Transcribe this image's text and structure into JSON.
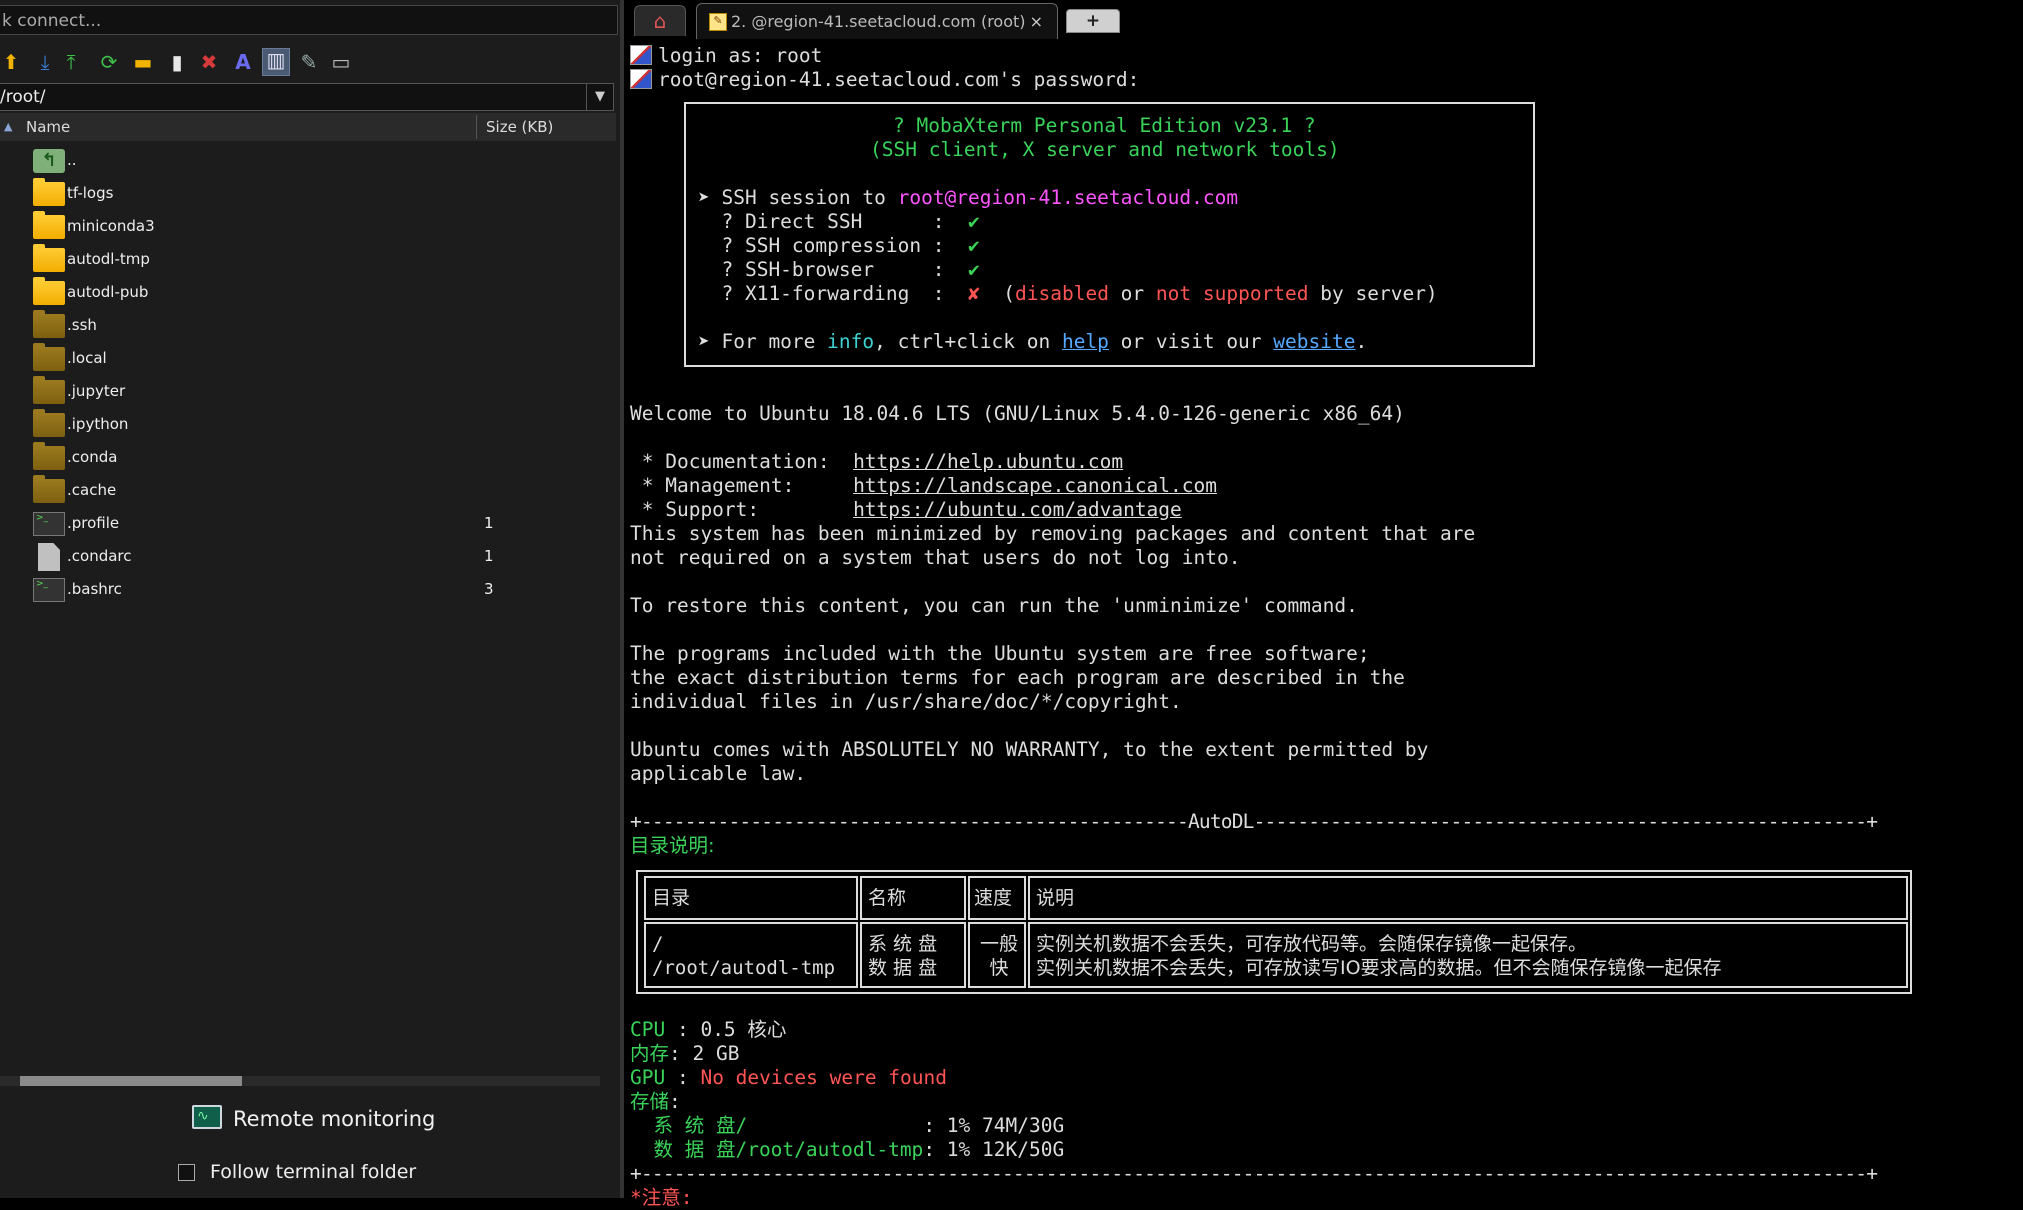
{
  "left_panel": {
    "quick_connect": "k connect...",
    "path": "/root/",
    "columns": {
      "name": "Name",
      "size": "Size (KB)"
    },
    "files": [
      {
        "name": "..",
        "size": "",
        "icon": "up-folder-icon"
      },
      {
        "name": "tf-logs",
        "size": "",
        "icon": "folder-icon"
      },
      {
        "name": "miniconda3",
        "size": "",
        "icon": "folder-icon"
      },
      {
        "name": "autodl-tmp",
        "size": "",
        "icon": "folder-icon"
      },
      {
        "name": "autodl-pub",
        "size": "",
        "icon": "folder-icon"
      },
      {
        "name": ".ssh",
        "size": "",
        "icon": "hidden-folder-icon"
      },
      {
        "name": ".local",
        "size": "",
        "icon": "hidden-folder-icon"
      },
      {
        "name": ".jupyter",
        "size": "",
        "icon": "hidden-folder-icon"
      },
      {
        "name": ".ipython",
        "size": "",
        "icon": "hidden-folder-icon"
      },
      {
        "name": ".conda",
        "size": "",
        "icon": "hidden-folder-icon"
      },
      {
        "name": ".cache",
        "size": "",
        "icon": "hidden-folder-icon"
      },
      {
        "name": ".profile",
        "size": "1",
        "icon": "terminal-file-icon"
      },
      {
        "name": ".condarc",
        "size": "1",
        "icon": "document-file-icon"
      },
      {
        "name": ".bashrc",
        "size": "3",
        "icon": "terminal-file-icon"
      }
    ],
    "remote_monitoring": "Remote monitoring",
    "follow_terminal": "Follow terminal folder"
  },
  "tabs": {
    "home_icon": "home-icon",
    "active_label": "2. @region-41.seetacloud.com (root)",
    "close": "×",
    "new_tab": "+"
  },
  "terminal": {
    "login": "login as: root",
    "password": "root@region-41.seetacloud.com's password:",
    "banner": {
      "title": "? MobaXterm Personal Edition v23.1 ?",
      "subtitle": "(SSH client, X server and network tools)",
      "session_prefix": "➤ SSH session to ",
      "session_host": "root@region-41.seetacloud.com",
      "direct_ssh": "  ? Direct SSH      :  ",
      "compression": "  ? SSH compression :  ",
      "browser": "  ? SSH-browser     :  ",
      "x11": "  ? X11-forwarding  :  ",
      "check": "✔",
      "cross": "✘",
      "x11_open": "  (",
      "disabled": "disabled",
      "or": " or ",
      "not_supported": "not supported",
      "by_server": " by server)",
      "more_prefix": "➤ For more ",
      "info": "info",
      "ctrl_click": ", ctrl+click on ",
      "help": "help",
      "or_visit": " or visit our ",
      "website": "website",
      "dot": "."
    },
    "welcome": "Welcome to Ubuntu 18.04.6 LTS (GNU/Linux 5.4.0-126-generic x86_64)",
    "doc_label": " * Documentation:  ",
    "doc_url": "https://help.ubuntu.com",
    "mgmt_label": " * Management:     ",
    "mgmt_url": "https://landscape.canonical.com",
    "support_label": " * Support:        ",
    "support_url": "https://ubuntu.com/advantage",
    "minimized1": "This system has been minimized by removing packages and content that are",
    "minimized2": "not required on a system that users do not log into.",
    "restore": "To restore this content, you can run the 'unminimize' command.",
    "programs1": "The programs included with the Ubuntu system are free software;",
    "programs2": "the exact distribution terms for each program are described in the",
    "programs3": "individual files in /usr/share/doc/*/copyright.",
    "warranty1": "Ubuntu comes with ABSOLUTELY NO WARRANTY, to the extent permitted by",
    "warranty2": "applicable law.",
    "autodl_rule": "+--------------------------------------------------AutoDL--------------------------------------------------------+",
    "dir_heading": "目录说明:",
    "table": {
      "h_dir": "目录",
      "h_name": "名称",
      "h_speed": "速度",
      "h_desc": "说明",
      "r1_dir": "/",
      "r2_dir": "/root/autodl-tmp",
      "r1_name": "系 统 盘",
      "r2_name": "数 据 盘",
      "r1_speed": "一般",
      "r2_speed": "快",
      "r1_desc": "实例关机数据不会丢失，可存放代码等。会随保存镜像一起保存。",
      "r2_desc": "实例关机数据不会丢失，可存放读写IO要求高的数据。但不会随保存镜像一起保存"
    },
    "cpu_label": "CPU ",
    "cpu_value": ": 0.5 核心",
    "mem_label": "内存",
    "mem_value": ": 2 GB",
    "gpu_label": "GPU ",
    "gpu_colon": ": ",
    "gpu_value": "No devices were found",
    "storage_label": "存储",
    "storage_colon": ":",
    "sys_disk": "  系 统 盘/               ",
    "sys_disk_value": ": 1% 74M/30G",
    "data_disk": "  数 据 盘/root/autodl-tmp",
    "data_disk_value": ": 1% 12K/50G",
    "bottom_rule": "+----------------------------------------------------------------------------------------------------------------+",
    "note": "*注意:"
  },
  "colors": {
    "green": "#3ad35a",
    "cyan": "#3fd1d1",
    "magenta": "#ff55ff",
    "red": "#ff5555",
    "link": "#55aaff"
  }
}
